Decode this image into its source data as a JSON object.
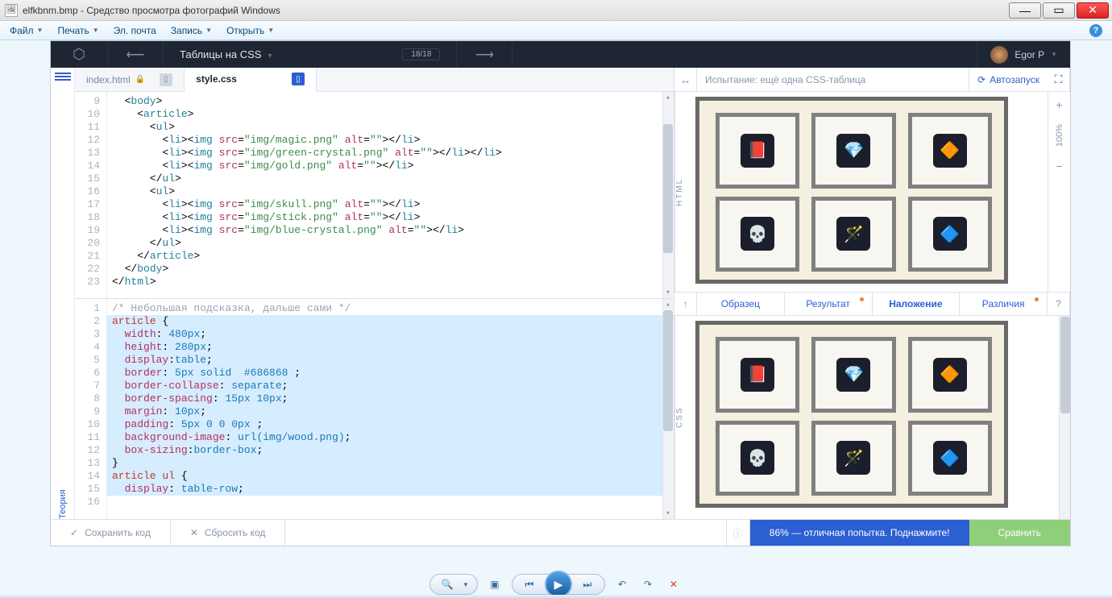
{
  "window": {
    "title": "elfkbnm.bmp - Средство просмотра фотографий Windows"
  },
  "menubar": {
    "file": "Файл",
    "print": "Печать",
    "email": "Эл. почта",
    "burn": "Запись",
    "open": "Открыть"
  },
  "header": {
    "lesson": "Таблицы на CSS",
    "counter": "18/18",
    "user": "Egor P"
  },
  "sidebar": {
    "theory": "Теория"
  },
  "tabs": {
    "index": "index.html",
    "style": "style.css"
  },
  "html_editor": {
    "lines": [
      "9",
      "10",
      "11",
      "12",
      "13",
      "14",
      "15",
      "16",
      "17",
      "18",
      "19",
      "20",
      "21",
      "22",
      "23",
      " "
    ],
    "rows": [
      {
        "indent": 2,
        "type": "open",
        "tag": "body"
      },
      {
        "indent": 4,
        "type": "open",
        "tag": "article"
      },
      {
        "indent": 6,
        "type": "open",
        "tag": "ul"
      },
      {
        "indent": 8,
        "type": "img",
        "src": "img/magic.png"
      },
      {
        "indent": 8,
        "type": "img",
        "src": "img/green-crystal.png",
        "trail": "</li>"
      },
      {
        "indent": 8,
        "type": "img",
        "src": "img/gold.png"
      },
      {
        "indent": 6,
        "type": "close",
        "tag": "ul"
      },
      {
        "indent": 6,
        "type": "open",
        "tag": "ul"
      },
      {
        "indent": 8,
        "type": "img",
        "src": "img/skull.png"
      },
      {
        "indent": 8,
        "type": "img",
        "src": "img/stick.png"
      },
      {
        "indent": 8,
        "type": "img",
        "src": "img/blue-crystal.png"
      },
      {
        "indent": 6,
        "type": "close",
        "tag": "ul"
      },
      {
        "indent": 4,
        "type": "close",
        "tag": "article"
      },
      {
        "indent": 2,
        "type": "close",
        "tag": "body"
      },
      {
        "indent": 0,
        "type": "close",
        "tag": "html"
      },
      {
        "indent": 0,
        "type": "blank"
      }
    ]
  },
  "css_editor": {
    "lines": [
      "1",
      "2",
      "3",
      "4",
      "5",
      "6",
      "7",
      "8",
      "9",
      "10",
      "11",
      "12",
      "13",
      "14",
      "15",
      "16"
    ],
    "rows": [
      {
        "type": "comment",
        "text": "/* Небольшая подсказка, дальше сами */"
      },
      {
        "type": "selopen",
        "sel": "article"
      },
      {
        "type": "decl",
        "prop": "width",
        "val": "480px"
      },
      {
        "type": "decl",
        "prop": "height",
        "val": "280px"
      },
      {
        "type": "decl",
        "prop": "display",
        "val": "table",
        "sep": ":"
      },
      {
        "type": "decl",
        "prop": "border",
        "val": "5px solid  #686868 "
      },
      {
        "type": "decl",
        "prop": "border-collapse",
        "val": "separate"
      },
      {
        "type": "decl",
        "prop": "border-spacing",
        "val": "15px 10px"
      },
      {
        "type": "decl",
        "prop": "margin",
        "val": "10px"
      },
      {
        "type": "decl",
        "prop": "padding",
        "val": "5px 0 0 0px "
      },
      {
        "type": "decl",
        "prop": "background-image",
        "val": "url(img/wood.png)"
      },
      {
        "type": "decl",
        "prop": "box-sizing",
        "val": "border-box",
        "sep": ":"
      },
      {
        "type": "close"
      },
      {
        "type": "selopen",
        "sel": "article ul"
      },
      {
        "type": "decl",
        "prop": "display",
        "val": "table-row"
      },
      {
        "type": "blank"
      }
    ]
  },
  "preview": {
    "challenge_label": "Испытание: ещё одна CSS-таблица",
    "autorun": "Автозапуск",
    "html_label": "HTML",
    "css_label": "CSS",
    "zoom": "100%",
    "items_row1": [
      "📕",
      "💎",
      "🔶"
    ],
    "items_row2": [
      "💀",
      "🪄",
      "🔷"
    ]
  },
  "compare": {
    "sample": "Образец",
    "result": "Результат",
    "overlay": "Наложение",
    "diff": "Различия"
  },
  "footer": {
    "save": "Сохранить код",
    "reset": "Сбросить код",
    "score": "86% — отличная попытка. Поднажмите!",
    "compare": "Сравнить"
  }
}
